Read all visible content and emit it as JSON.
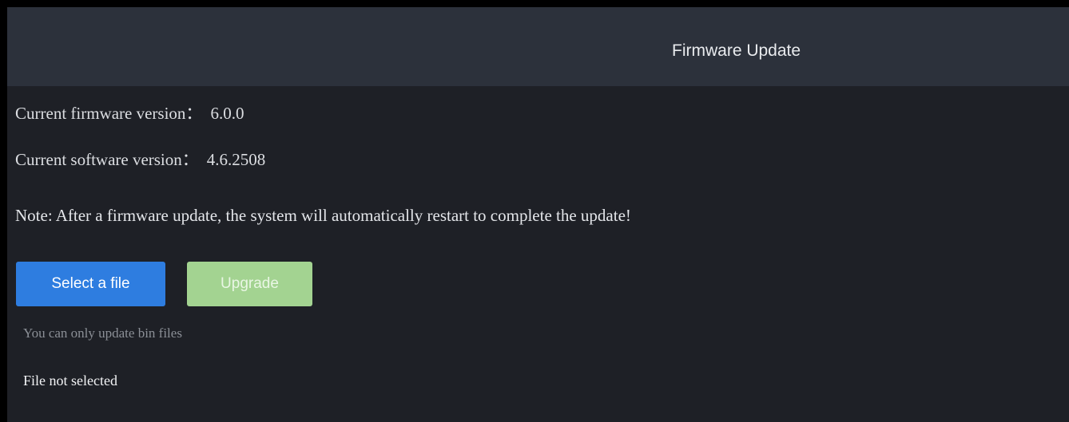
{
  "dialog": {
    "title": "Firmware Update"
  },
  "info": {
    "firmware_label": "Current firmware version：",
    "firmware_value": "6.0.0",
    "software_label": "Current software version：",
    "software_value": "4.6.2508"
  },
  "note": "Note: After a firmware update, the system will automatically restart to complete the update!",
  "actions": {
    "select_file_label": "Select a file",
    "upgrade_label": "Upgrade",
    "upgrade_disabled": true
  },
  "hint": "You can only update bin files",
  "file_status": "File not selected",
  "colors": {
    "background": "#1e2026",
    "header": "#2c313b",
    "primary_button": "#2e7de0",
    "upgrade_button_disabled": "#a3d391",
    "hint_text": "#8b8f96"
  }
}
